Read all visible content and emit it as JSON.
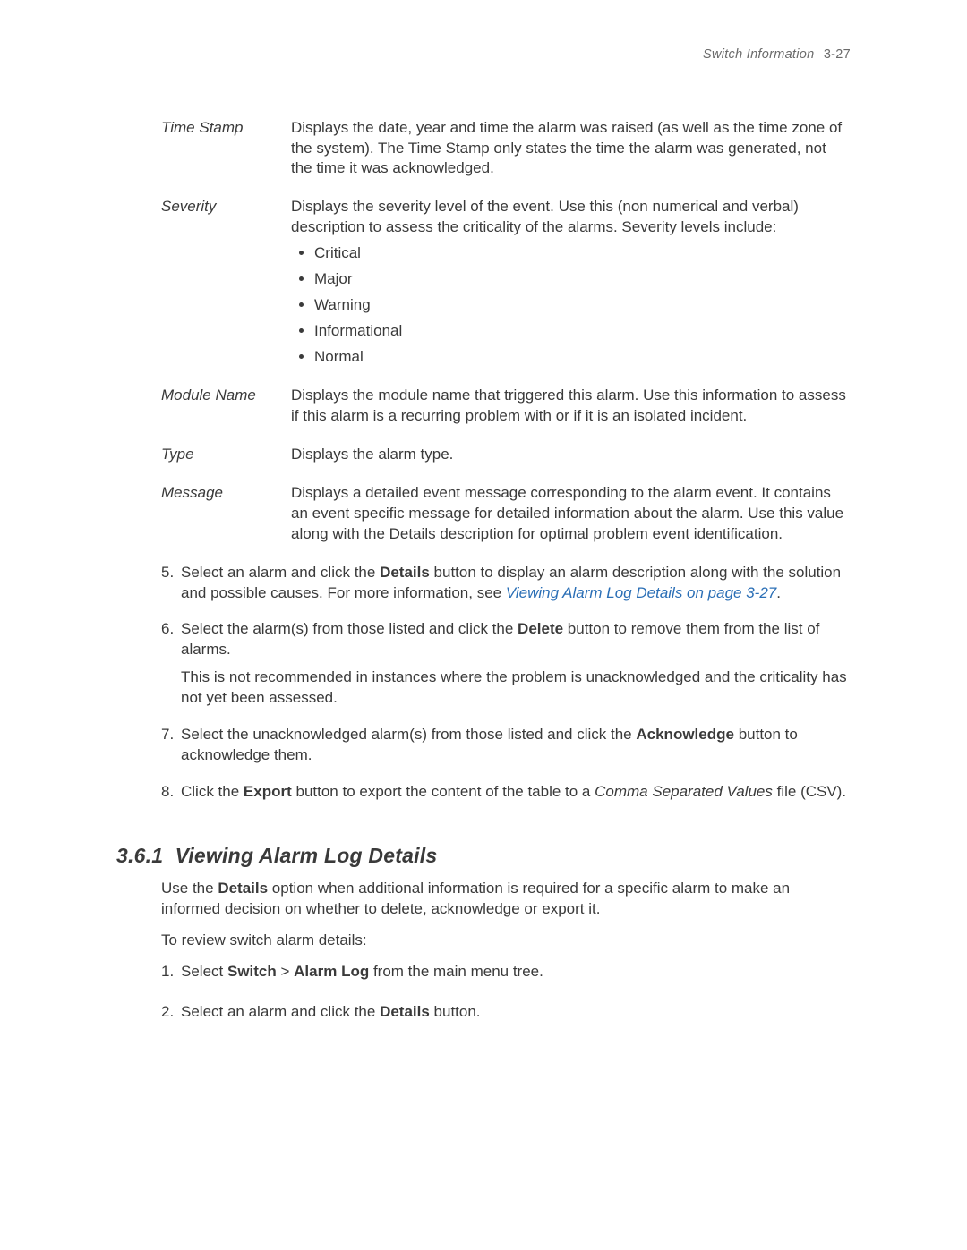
{
  "header": {
    "title": "Switch Information",
    "pagenum": "3-27"
  },
  "definitions": {
    "time_stamp": {
      "term": "Time Stamp",
      "desc": "Displays the date, year and time the alarm was raised (as well as the time zone of the system). The Time Stamp only states the time the alarm was generated, not the time it was acknowledged."
    },
    "severity": {
      "term": "Severity",
      "desc": "Displays the severity level of the event. Use this (non numerical and verbal) description to assess the criticality of the alarms. Severity levels include:",
      "levels": {
        "l1": "Critical",
        "l2": "Major",
        "l3": "Warning",
        "l4": "Informational",
        "l5": "Normal"
      }
    },
    "module_name": {
      "term": "Module Name",
      "desc": "Displays the module name that triggered this alarm. Use this information to assess if this alarm is a recurring problem with or if it is an isolated incident."
    },
    "type": {
      "term": "Type",
      "desc": "Displays the alarm type."
    },
    "message": {
      "term": "Message",
      "desc": "Displays a detailed event message corresponding to the alarm event. It contains an event specific message for detailed information about the alarm. Use this value along with the Details description for optimal problem event identification."
    }
  },
  "steps": {
    "s5": {
      "num": "5.",
      "t1": "Select an alarm and click the ",
      "b1": "Details",
      "t2": " button to display an alarm description along with the solution and possible causes. For more information, see ",
      "link": "Viewing Alarm Log Details on page 3-27",
      "t3": "."
    },
    "s6": {
      "num": "6.",
      "t1": "Select the alarm(s) from those listed and click the ",
      "b1": "Delete",
      "t2": " button to remove them from the list of alarms.",
      "sub": "This is not recommended in instances where the problem is unacknowledged and the criticality has not yet been assessed."
    },
    "s7": {
      "num": "7.",
      "t1": "Select the unacknowledged alarm(s) from those listed and click the ",
      "b1": "Acknowledge",
      "t2": " button to acknowledge them."
    },
    "s8": {
      "num": "8.",
      "t1": "Click the ",
      "b1": "Export",
      "t2": " button to export the content of the table to a ",
      "i1": "Comma Separated Values",
      "t3": " file (CSV)."
    }
  },
  "section": {
    "number": "3.6.1",
    "title": "Viewing Alarm Log Details",
    "p1_a": "Use the ",
    "p1_b": "Details",
    "p1_c": " option when additional information is required for a specific alarm to make an informed decision on whether to delete, acknowledge or export it.",
    "p2": "To review switch alarm details:",
    "st1": {
      "num": "1.",
      "t1": "Select ",
      "b1": "Switch",
      "t2": " > ",
      "b2": "Alarm Log",
      "t3": " from the main menu tree."
    },
    "st2": {
      "num": "2.",
      "t1": "Select an alarm and click the ",
      "b1": "Details",
      "t2": " button."
    }
  }
}
